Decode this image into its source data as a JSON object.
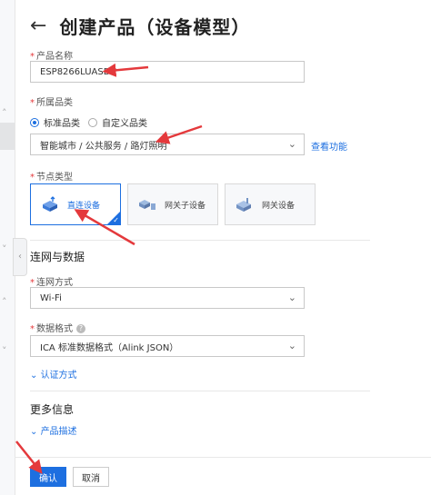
{
  "header": {
    "back_icon": "arrow-left-icon",
    "title": "创建产品（设备模型）"
  },
  "product_name": {
    "label": "产品名称",
    "value": "ESP8266LUASDK"
  },
  "category": {
    "label": "所属品类",
    "options": [
      "标准品类",
      "自定义品类"
    ],
    "selected": "智能城市 / 公共服务 / 路灯照明",
    "link": "查看功能"
  },
  "node_type": {
    "label": "节点类型",
    "cards": [
      "直连设备",
      "网关子设备",
      "网关设备"
    ]
  },
  "network": {
    "section_title": "连网与数据",
    "method_label": "连网方式",
    "method_value": "Wi-Fi",
    "format_label": "数据格式",
    "format_value": "ICA 标准数据格式（Alink JSON）",
    "auth_toggle": "认证方式"
  },
  "more": {
    "section_title": "更多信息",
    "desc_toggle": "产品描述"
  },
  "actions": {
    "confirm": "确认",
    "cancel": "取消"
  },
  "colors": {
    "primary": "#1d6fe0",
    "required": "#e4393c",
    "annotation": "#e4393c"
  }
}
